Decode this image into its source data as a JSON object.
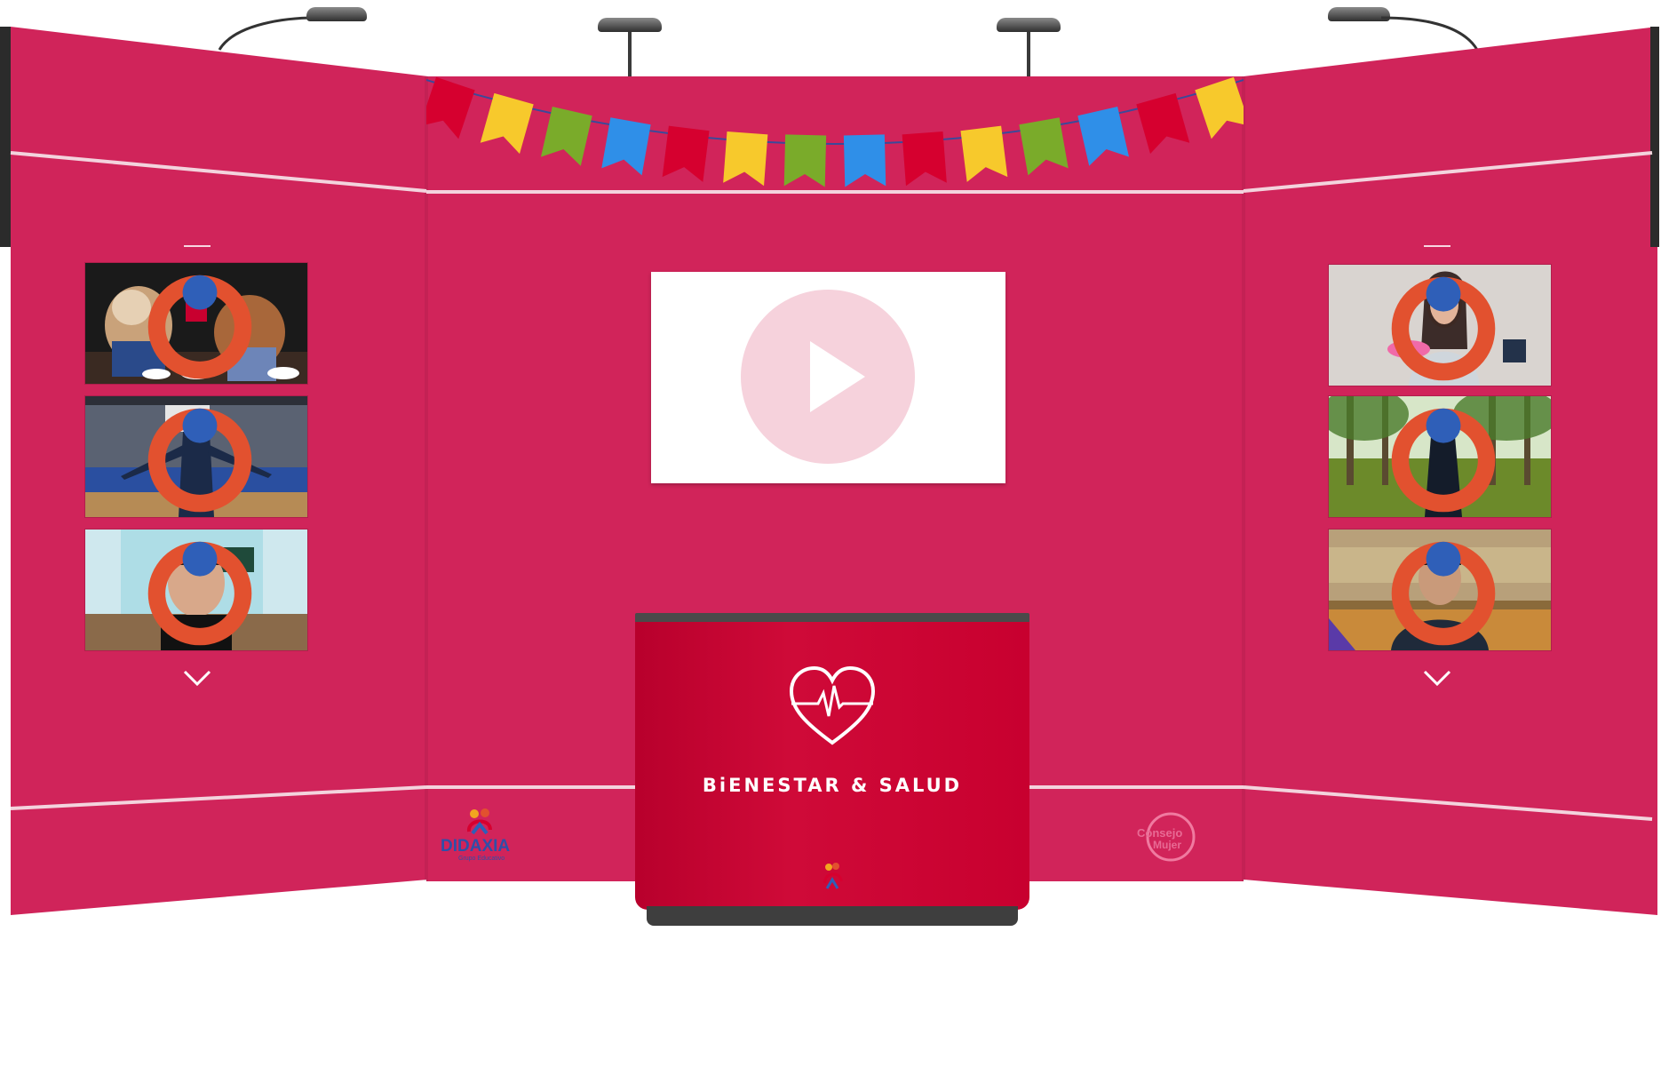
{
  "booth": {
    "counter_title": "BiENESTAR & SALUD",
    "colors": {
      "wall": "#d1245a",
      "counter": "#c8002f",
      "screen_play": "#f6d2dc"
    }
  },
  "main_screen": {
    "icon": "play-icon"
  },
  "left_panel": {
    "videos": [
      {
        "name": "puppets-breakfast-video"
      },
      {
        "name": "woman-gym-video"
      },
      {
        "name": "man-classroom-video"
      }
    ],
    "more_icon": "chevron-down-icon"
  },
  "right_panel": {
    "videos": [
      {
        "name": "woman-holding-objects-video"
      },
      {
        "name": "woman-park-video"
      },
      {
        "name": "man-gym-hall-video"
      }
    ],
    "more_icon": "chevron-down-icon"
  },
  "logos": {
    "didaxia": {
      "text": "DIDAXIA",
      "subtext": "Grupo Educativo"
    },
    "consejo": {
      "text_top": "Consejo",
      "text_bottom": "Mujer"
    }
  },
  "bunting_colors": [
    "#d6002f",
    "#f7c92c",
    "#7aab2a",
    "#2f8fe8",
    "#d6002f",
    "#f7c92c",
    "#7aab2a",
    "#2f8fe8",
    "#d6002f",
    "#f7c92c",
    "#7aab2a",
    "#2f8fe8",
    "#d6002f",
    "#f7c92c"
  ]
}
